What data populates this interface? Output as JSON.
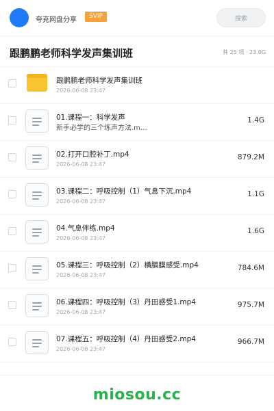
{
  "header": {
    "username": "夸克网盘分享",
    "badge": "SVIP",
    "search_placeholder": "搜索"
  },
  "folder": {
    "title": "跟鹏鹏老师科学发声集训班",
    "meta": "共 25 项 · 23.0G"
  },
  "items": [
    {
      "type": "folder",
      "name": "跟鹏鹏老师科学发声集训班",
      "date": "2026-06-08 23:47",
      "size": ""
    },
    {
      "type": "file",
      "name": "01.课程一：科学发声",
      "subtitle": "新手必学的三个练声方法.m…",
      "date": "",
      "size": "1.4G"
    },
    {
      "type": "file",
      "name": "02.打开口腔补丁.mp4",
      "date": "2026-06-08 23:47",
      "size": "879.2M"
    },
    {
      "type": "file",
      "name": "03.课程二：呼吸控制（1）气息下沉.mp4",
      "date": "2026-06-08 23:47",
      "size": "1.1G"
    },
    {
      "type": "file",
      "name": "04.气息伴练.mp4",
      "date": "2026-06-08 23:47",
      "size": "1.6G"
    },
    {
      "type": "file",
      "name": "05.课程三：呼吸控制（2）横膈膜感受.mp4",
      "date": "2026-06-08 23:47",
      "size": "784.6M"
    },
    {
      "type": "file",
      "name": "06.课程四：呼吸控制（3）丹田感受1.mp4",
      "date": "2026-06-08 23:47",
      "size": "975.7M"
    },
    {
      "type": "file",
      "name": "07.课程五：呼吸控制（4）丹田感受2.mp4",
      "date": "2026-06-08 23:47",
      "size": "966.7M"
    }
  ],
  "footer": {
    "watermark": "miosou.cc"
  },
  "colors": {
    "accent": "#1f7cf6",
    "badge": "#f7a13a",
    "folder": "#f7c531",
    "watermark": "#2bb24c"
  }
}
